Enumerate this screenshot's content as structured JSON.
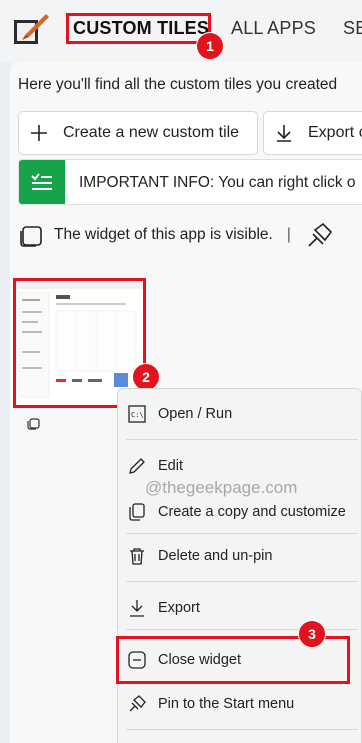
{
  "nav": {
    "tabs": [
      {
        "label": "CUSTOM TILES",
        "active": true
      },
      {
        "label": "ALL APPS",
        "active": false
      },
      {
        "label": "SE",
        "active": false
      }
    ]
  },
  "intro_text": "Here you'll find all the custom tiles you created",
  "toolbar": {
    "create_label": "Create a new custom tile",
    "export_label": "Export c"
  },
  "info_bar": {
    "text": "IMPORTANT INFO: You can right click o",
    "accent": "#16a34a"
  },
  "widget_status": {
    "text": "The widget of this app is visible.",
    "separator": "|"
  },
  "context_menu": {
    "items": [
      {
        "label": "Open / Run",
        "icon": "terminal-icon"
      },
      {
        "label": "Edit",
        "icon": "pencil-icon"
      },
      {
        "label": "Create a copy and customize",
        "icon": "copy-icon"
      },
      {
        "label": "Delete and un-pin",
        "icon": "trash-icon"
      },
      {
        "label": "Export",
        "icon": "download-icon"
      },
      {
        "label": "Close widget",
        "icon": "widget-icon"
      },
      {
        "label": "Pin to the Start menu",
        "icon": "pin-icon"
      }
    ]
  },
  "watermark": "@thegeekpage.com",
  "annotations": {
    "badge_1": "1",
    "badge_2": "2",
    "badge_3": "3",
    "highlight_color": "#e0141e"
  }
}
